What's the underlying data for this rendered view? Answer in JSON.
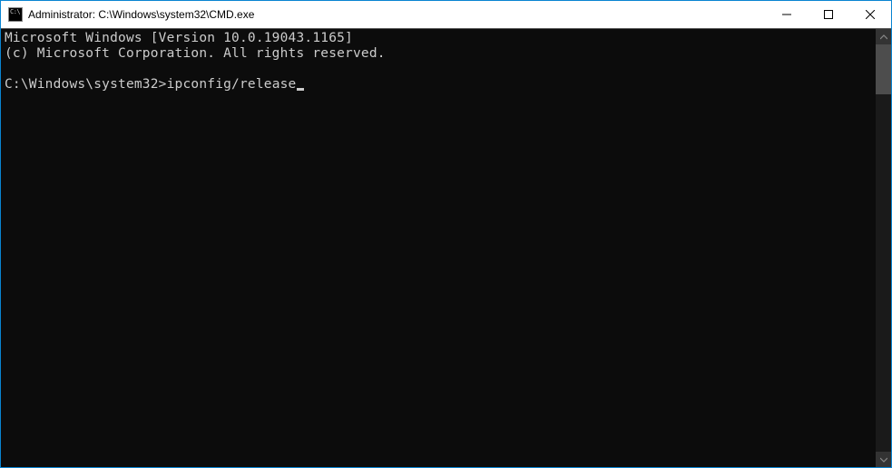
{
  "window": {
    "title": "Administrator: C:\\Windows\\system32\\CMD.exe"
  },
  "console": {
    "line1": "Microsoft Windows [Version 10.0.19043.1165]",
    "line2": "(c) Microsoft Corporation. All rights reserved.",
    "blank": "",
    "prompt": "C:\\Windows\\system32>",
    "command": "ipconfig/release"
  }
}
